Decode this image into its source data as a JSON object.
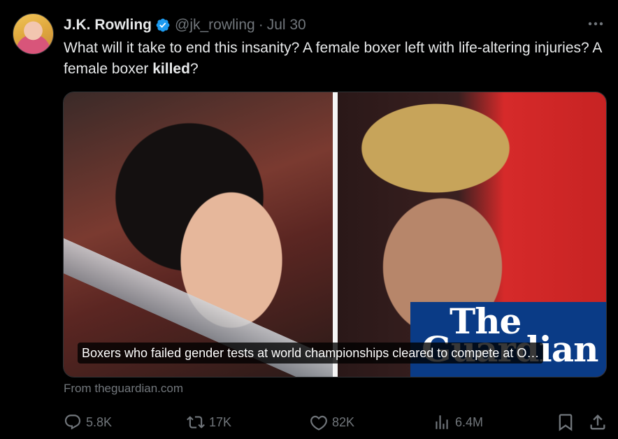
{
  "author": {
    "name": "J.K. Rowling",
    "handle": "@jk_rowling",
    "separator": "·",
    "date": "Jul 30"
  },
  "tweet": {
    "text_part1": "What will it take to end this insanity? A  female boxer left with life-altering injuries? A female boxer ",
    "text_bold": "killed",
    "text_part2": "?"
  },
  "card": {
    "logo_line1": "The",
    "logo_line2": "Guardian",
    "caption": "Boxers who failed gender tests at world championships cleared to compete at O…",
    "source": "From theguardian.com"
  },
  "actions": {
    "reply_count": "5.8K",
    "retweet_count": "17K",
    "like_count": "82K",
    "views_count": "6.4M"
  },
  "icons": {
    "verified": "verified-badge-icon",
    "more": "more-options-icon",
    "reply": "reply-icon",
    "retweet": "retweet-icon",
    "like": "heart-icon",
    "views": "views-icon",
    "bookmark": "bookmark-icon",
    "share": "share-icon"
  },
  "colors": {
    "background": "#000000",
    "text": "#e7e9ea",
    "muted": "#71767b",
    "verified": "#1d9bf0",
    "guardian_blue": "#0a3b86"
  }
}
